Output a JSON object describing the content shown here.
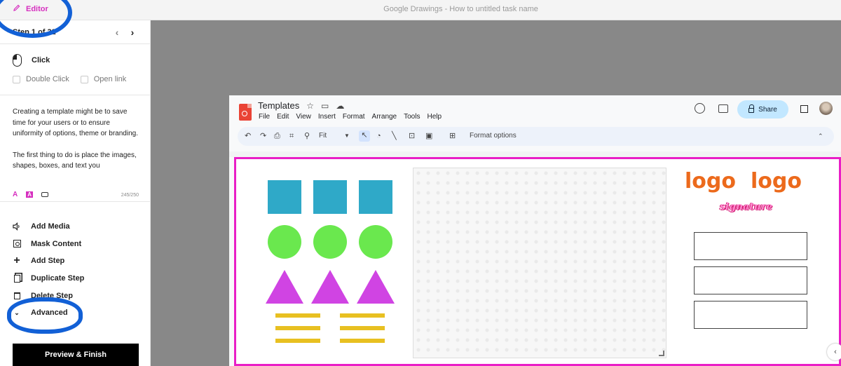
{
  "topbar": {
    "editor_label": "Editor",
    "page_title": "Google Drawings - How to untitled task name"
  },
  "panel": {
    "step_label": "Step 1 of 32",
    "action": "Click",
    "options": [
      "Double Click",
      "Open link"
    ],
    "description_p1": "Creating a template might be to save time for your users or to ensure uniformity of options, theme or branding.",
    "description_p2": "The first thing to do is place the images, shapes, boxes, and text you",
    "char_count": "245/250",
    "menu": [
      "Add Media",
      "Mask Content",
      "Add Step",
      "Duplicate Step",
      "Delete Step",
      "Advanced"
    ],
    "preview_button": "Preview & Finish"
  },
  "drawings": {
    "doc_title": "Templates",
    "menus": [
      "File",
      "Edit",
      "View",
      "Insert",
      "Format",
      "Arrange",
      "Tools",
      "Help"
    ],
    "share_label": "Share",
    "zoom": "Fit",
    "format_options": "Format options",
    "logo_text_1": "logo",
    "logo_text_2": "logo",
    "signature": "signature"
  },
  "colors": {
    "accent": "#d62fbf",
    "canvas_border": "#e91ec6",
    "square": "#2fa9c8",
    "circle": "#6ae84e",
    "triangle": "#d044e3",
    "bar": "#e8c021",
    "logo": "#ec6a1c",
    "share_bg": "#c2e7ff",
    "scribble": "#1260d6"
  }
}
